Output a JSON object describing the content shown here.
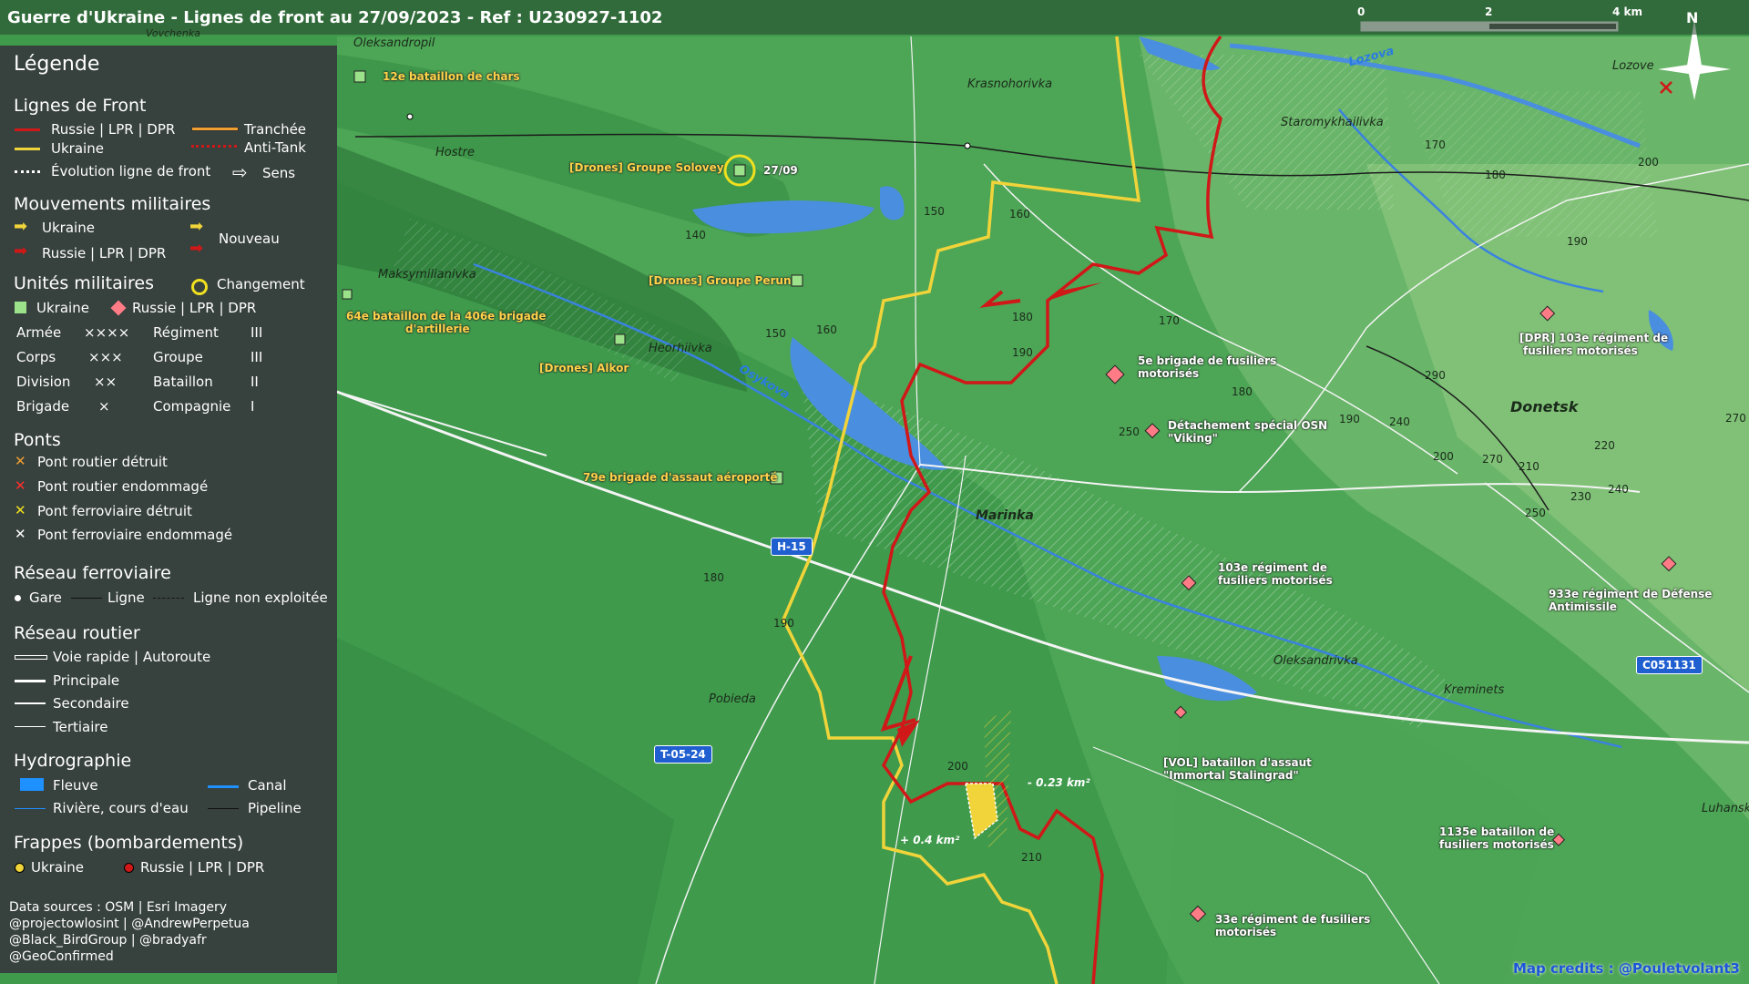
{
  "title": "Guerre d'Ukraine - Lignes de front au 27/09/2023 - Ref : U230927-1102",
  "colors": {
    "ukraine_line": "#f0d43a",
    "russia_line": "#d01818",
    "legend_bg": "#373a3c",
    "badge_blue": "#1f5fd0"
  },
  "legend": {
    "title": "Légende",
    "front_lines": {
      "heading": "Lignes de Front",
      "russia": "Russie | LPR | DPR",
      "ukraine": "Ukraine",
      "evolution": "Évolution ligne de front",
      "trench": "Tranchée",
      "antitank": "Anti-Tank",
      "direction": "Sens"
    },
    "movements": {
      "heading": "Mouvements militaires",
      "ukraine": "Ukraine",
      "russia": "Russie | LPR | DPR",
      "new": "Nouveau"
    },
    "units": {
      "heading": "Unités militaires",
      "change": "Changement",
      "ukraine": "Ukraine",
      "russia": "Russie | LPR | DPR",
      "rows": [
        {
          "a": "Armée",
          "as": "××××",
          "b": "Régiment",
          "bs": "III"
        },
        {
          "a": "Corps",
          "as": "×××",
          "b": "Groupe",
          "bs": "III"
        },
        {
          "a": "Division",
          "as": "××",
          "b": "Bataillon",
          "bs": "II"
        },
        {
          "a": "Brigade",
          "as": "×",
          "b": "Compagnie",
          "bs": "I"
        }
      ]
    },
    "bridges": {
      "heading": "Ponts",
      "items": [
        "Pont routier détruit",
        "Pont routier endommagé",
        "Pont ferroviaire détruit",
        "Pont ferroviaire endommagé"
      ]
    },
    "rail": {
      "heading": "Réseau ferroviaire",
      "station": "Gare",
      "line": "Ligne",
      "unused": "Ligne non exploitée"
    },
    "roads": {
      "heading": "Réseau routier",
      "items": [
        "Voie rapide | Autoroute",
        "Principale",
        "Secondaire",
        "Tertiaire"
      ]
    },
    "hydro": {
      "heading": "Hydrographie",
      "river_big": "Fleuve",
      "canal": "Canal",
      "stream": "Rivière, cours d'eau",
      "pipeline": "Pipeline"
    },
    "strikes": {
      "heading": "Frappes (bombardements)",
      "ukraine": "Ukraine",
      "russia": "Russie | LPR | DPR"
    },
    "sources": [
      "Data sources : OSM | Esri Imagery",
      "@projectowlosint | @AndrewPerpetua",
      "@Black_BirdGroup | @bradyafr",
      "@GeoConfirmed"
    ]
  },
  "scale": {
    "l0": "0",
    "l2": "2",
    "l4": "4 km"
  },
  "north": "N",
  "places": {
    "vovchenka": "Vovchenka",
    "oleksandropil": "Oleksandropil",
    "hostre": "Hostre",
    "krasnohorivka": "Krasnohorivka",
    "staromykhailivka": "Staromykhailivka",
    "lozove": "Lozove",
    "maksymilianivka": "Maksymilianivka",
    "heorhiivka": "Heorhiivka",
    "marinka": "Marinka",
    "donetsk": "Donetsk",
    "oleksandrivka": "Oleksandrivka",
    "kreminets": "Kreminets",
    "pobieda": "Pobieda",
    "luhanske": "Luhanske"
  },
  "rivers": {
    "osykova": "Osykova",
    "lozova": "Lozova"
  },
  "units_ua": {
    "tank12": "12e bataillon de chars",
    "solovey": "[Drones] Groupe Solovey",
    "solovey_date": "27/09",
    "perun": "[Drones] Groupe Perun",
    "art64a": "64e bataillon de la 406e brigade",
    "art64b": "d'artillerie",
    "alkor": "[Drones] Alkor",
    "b79": "79e brigade d'assaut aéroporté"
  },
  "units_ru": {
    "r103a": "[DPR] 103e régiment de",
    "r103b": "fusiliers motorisés",
    "b5a": "5e brigade de fusiliers",
    "b5b": "motorisés",
    "osna": "Détachement spécial OSN",
    "osnb": "\"Viking\"",
    "m103a": "103e régiment de",
    "m103b": "fusiliers motorisés",
    "r933a": "933e régiment de Défense",
    "r933b": "Antimissile",
    "vola": "[VOL] bataillon d'assaut",
    "volb": "\"Immortal Stalingrad\"",
    "b1135a": "1135e bataillon de",
    "b1135b": "fusiliers motorisés",
    "r33a": "33e régiment de fusiliers",
    "r33b": "motorisés"
  },
  "roads": {
    "h15": "H-15",
    "t0524": "T-05-24",
    "c051131": "C051131"
  },
  "area_changes": {
    "loss": "- 0.23 km²",
    "gain": "+ 0.4 km²"
  },
  "altitudes": {
    "a1": "150",
    "a2": "160",
    "a3": "140",
    "a4": "150",
    "a5": "160",
    "a6": "180",
    "a7": "190",
    "a8": "170",
    "a9": "180",
    "a10": "190",
    "a11": "240",
    "a12": "250",
    "a13": "200",
    "a14": "270",
    "a15": "210",
    "a16": "220",
    "a17": "230",
    "a18": "240",
    "a19": "250",
    "a20": "270",
    "a21": "290",
    "a22": "170",
    "a23": "180",
    "a24": "200",
    "a25": "190",
    "a26": "180",
    "a27": "190",
    "a28": "200",
    "a29": "210"
  },
  "credits": "Map credits : @Poulet­volant3"
}
